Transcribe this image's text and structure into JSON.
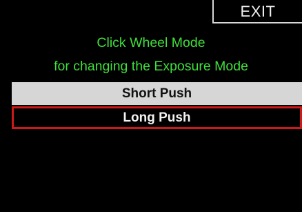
{
  "exit_label": "EXIT",
  "header": {
    "line1": "Click Wheel Mode",
    "line2": "for changing the Exposure Mode"
  },
  "menu": {
    "items": [
      {
        "label": "Short Push",
        "selected": false
      },
      {
        "label": "Long Push",
        "selected": true
      }
    ]
  },
  "colors": {
    "background": "#000000",
    "header_text": "#3fe03a",
    "selection_border": "#d01818",
    "item_background": "#d6d6d6"
  }
}
